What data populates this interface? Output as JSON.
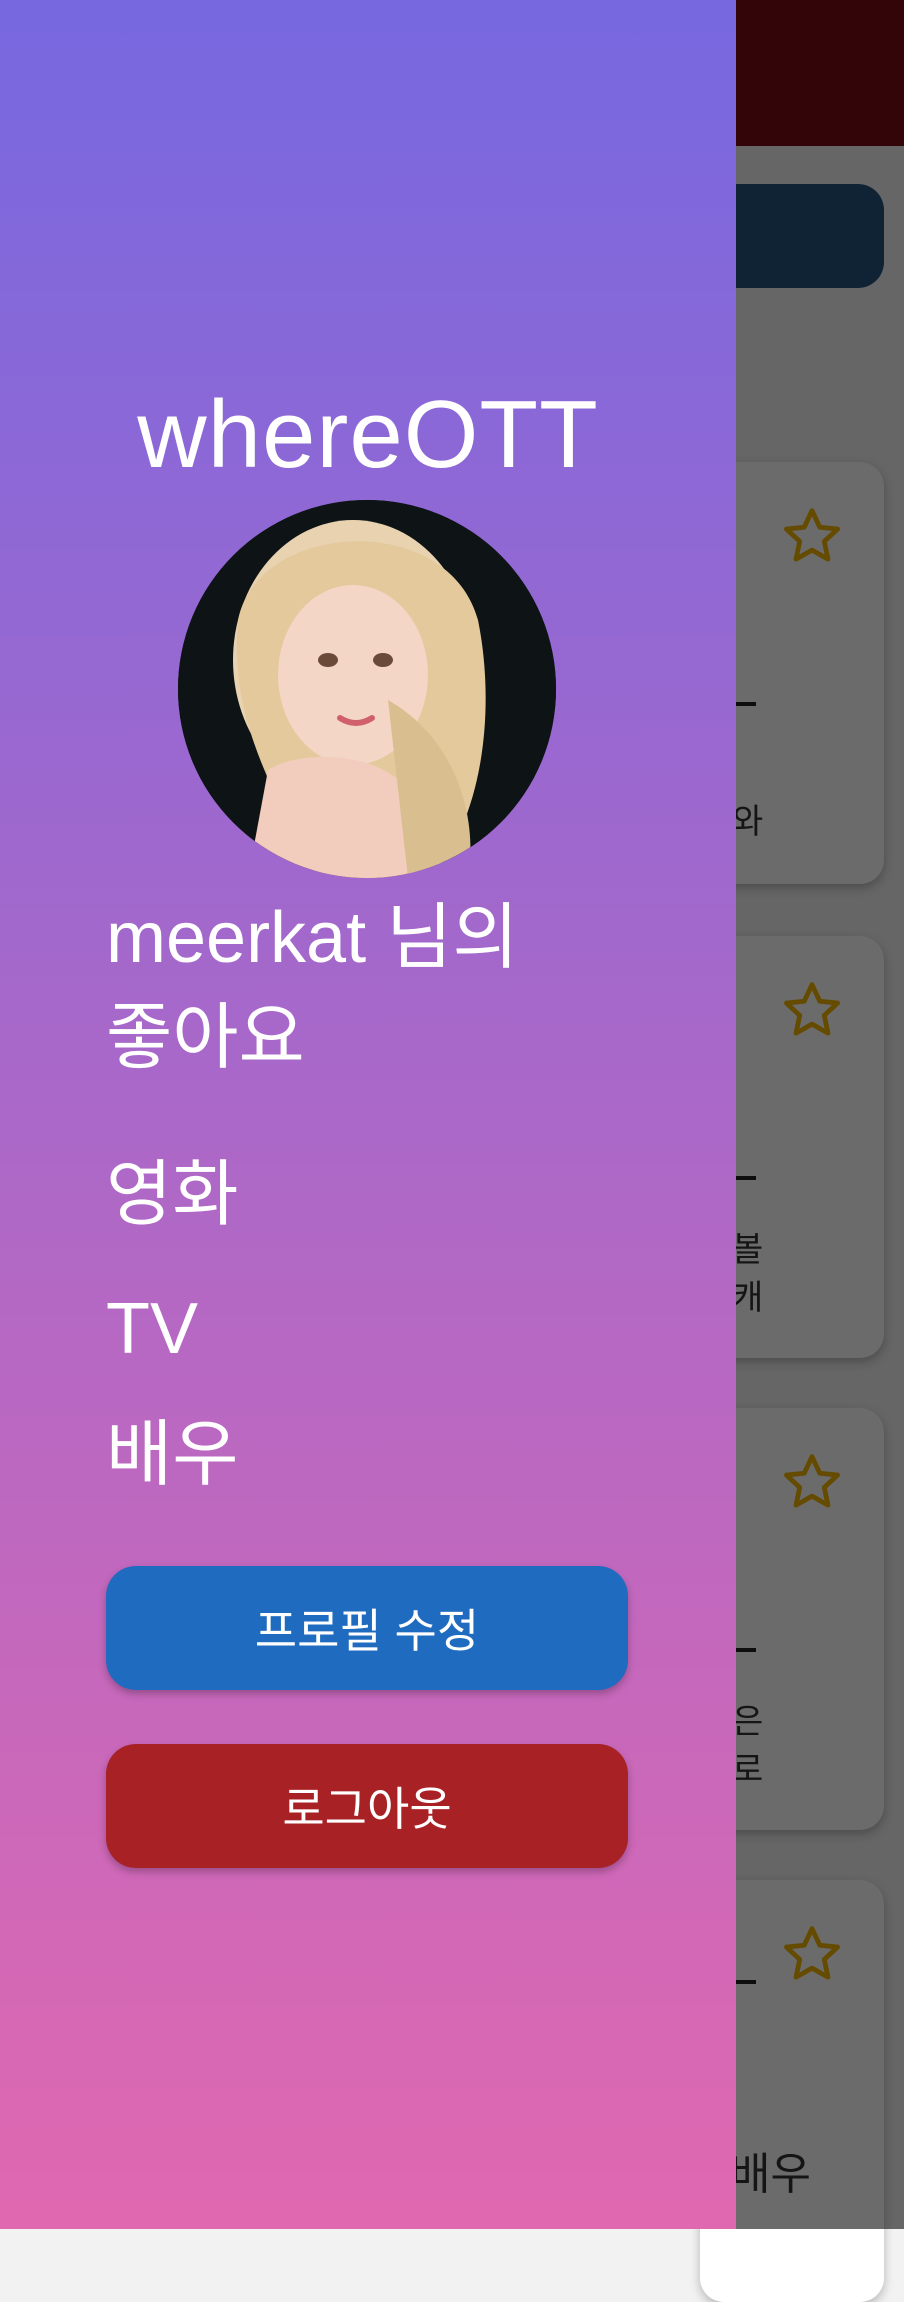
{
  "drawer": {
    "app_title": "whereOTT",
    "username_line1": "meerkat 님의",
    "username_line2": "좋아요",
    "menu": [
      {
        "label": "영화"
      },
      {
        "label": "TV"
      },
      {
        "label": "배우"
      }
    ],
    "edit_profile_label": "프로필 수정",
    "logout_label": "로그아웃"
  },
  "background": {
    "card_texts": [
      "와",
      "볼",
      "캐",
      "은",
      "로"
    ],
    "bottom_text": "배우"
  },
  "colors": {
    "gradient_top": "#7768e0",
    "gradient_bottom": "#e068b0",
    "edit_button": "#1f6bc0",
    "logout_button": "#a82124",
    "topbar": "#7a0a14",
    "star": "#f0b400"
  }
}
